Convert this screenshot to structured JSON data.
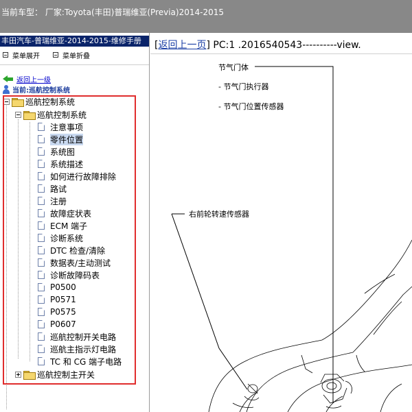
{
  "top_bar": {
    "title": "当前车型： 厂家:Toyota(丰田)普瑞维亚(Previa)2014-2015"
  },
  "left_panel": {
    "manual_title": "丰田汽车-普瑞维亚-2014-2015-维修手册",
    "expand_all": "菜单展开",
    "collapse_all": "菜单折叠",
    "back_link": "返回上一级",
    "current_label": "当前:巡航控制系统",
    "tree": {
      "root": "巡航控制系统",
      "group": "巡航控制系统",
      "items": [
        "注意事项",
        "零件位置",
        "系统图",
        "系统描述",
        "如何进行故障排除",
        "路试",
        "注册",
        "故障症状表",
        "ECM 端子",
        "诊断系统",
        "DTC 检查/清除",
        "数据表/主动测试",
        "诊断故障码表",
        "P0500",
        "P0571",
        "P0575",
        "P0607",
        "巡航控制开关电路",
        "巡航主指示灯电路",
        "TC 和 CG 端子电路"
      ],
      "collapsed": "巡航控制主开关"
    }
  },
  "right_panel": {
    "back_link": "返回上一页",
    "header_bracket_open": "[",
    "header_bracket_close": "]",
    "header_text": " PC:1 .2016540543----------view.",
    "callouts": {
      "throttle_body": "节气门体",
      "throttle_actuator": "- 节气门执行器",
      "throttle_sensor": "- 节气门位置传感器",
      "front_right_wheel_sensor": "右前轮转速传感器"
    }
  },
  "colors": {
    "top_bar": "#888888",
    "title_bar": "#0a246a",
    "highlight_box": "#e02c2c",
    "selected_item": "#c8d8ef",
    "link": "#1b3fa5"
  }
}
